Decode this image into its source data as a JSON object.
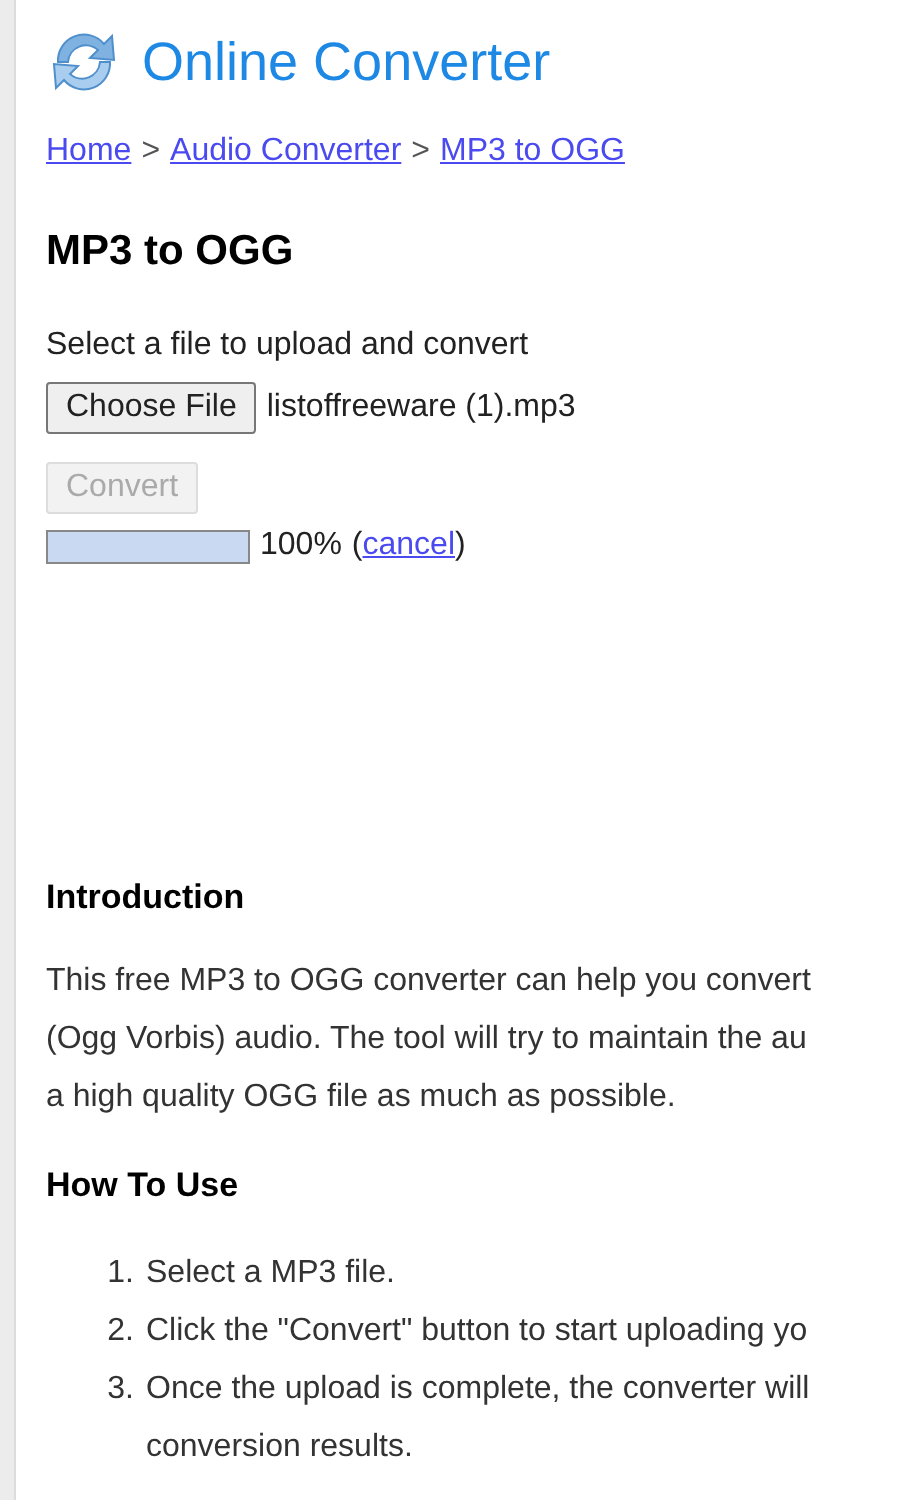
{
  "site": {
    "title": "Online Converter"
  },
  "breadcrumb": [
    {
      "label": "Home"
    },
    {
      "label": "Audio Converter"
    },
    {
      "label": "MP3 to OGG"
    }
  ],
  "breadcrumb_separator": ">",
  "heading": "MP3 to OGG",
  "upload": {
    "prompt": "Select a file to upload and convert",
    "choose_button": "Choose File",
    "file_name": "listoffreeware (1).mp3",
    "convert_button": {
      "label": "Convert",
      "disabled": true
    },
    "progress": {
      "level": 1.0,
      "percent": "100%",
      "open_paren": "(",
      "cancel": "cancel",
      "close_paren": ")"
    }
  },
  "introduction": {
    "title": "Introduction",
    "lines": [
      "This free MP3 to OGG converter can help you convert",
      "(Ogg Vorbis) audio. The tool will try to maintain the au",
      "a high quality OGG file as much as possible."
    ]
  },
  "how_to_use": {
    "title": "How To Use",
    "steps": [
      {
        "number": "1.",
        "lines": [
          "Select a MP3 file."
        ]
      },
      {
        "number": "2.",
        "lines": [
          "Click the \"Convert\" button to start uploading yo"
        ]
      },
      {
        "number": "3.",
        "lines": [
          "Once the upload is complete, the converter will",
          "conversion results."
        ]
      }
    ]
  }
}
